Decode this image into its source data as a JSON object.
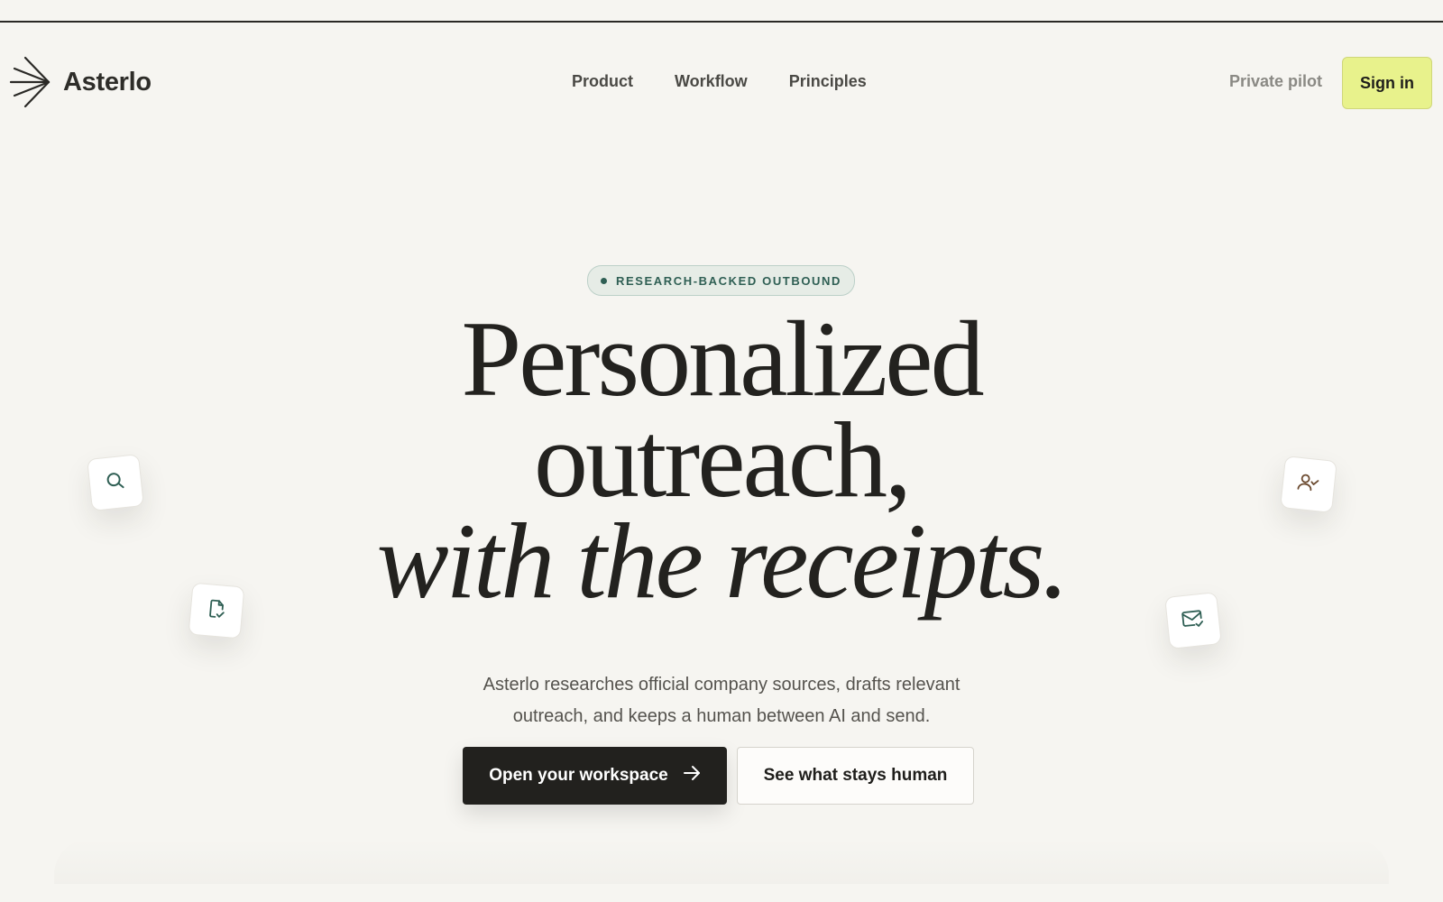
{
  "brand": {
    "name": "Asterlo",
    "logo_icon": "asterisk-arrow-icon"
  },
  "nav": {
    "items": [
      {
        "label": "Product"
      },
      {
        "label": "Workflow"
      },
      {
        "label": "Principles"
      }
    ],
    "pilot_label": "Private pilot",
    "signin_label": "Sign in"
  },
  "hero": {
    "badge": "RESEARCH-BACKED OUTBOUND",
    "headline_line1": "Personalized",
    "headline_line2": "outreach,",
    "headline_line3": "with the receipts.",
    "subtitle_line1": "Asterlo researches official company sources, drafts relevant",
    "subtitle_line2": "outreach, and keeps a human between AI and send.",
    "primary_cta": "Open your workspace",
    "secondary_cta": "See what stays human"
  },
  "floating_icons": [
    {
      "icon": "search-icon"
    },
    {
      "icon": "document-check-icon"
    },
    {
      "icon": "user-check-icon"
    },
    {
      "icon": "mail-check-icon"
    }
  ],
  "colors": {
    "background": "#f6f5f1",
    "accent": "#e8f28c",
    "teal": "#2f5f54",
    "dark": "#22211e",
    "brown": "#6b4a2f"
  }
}
